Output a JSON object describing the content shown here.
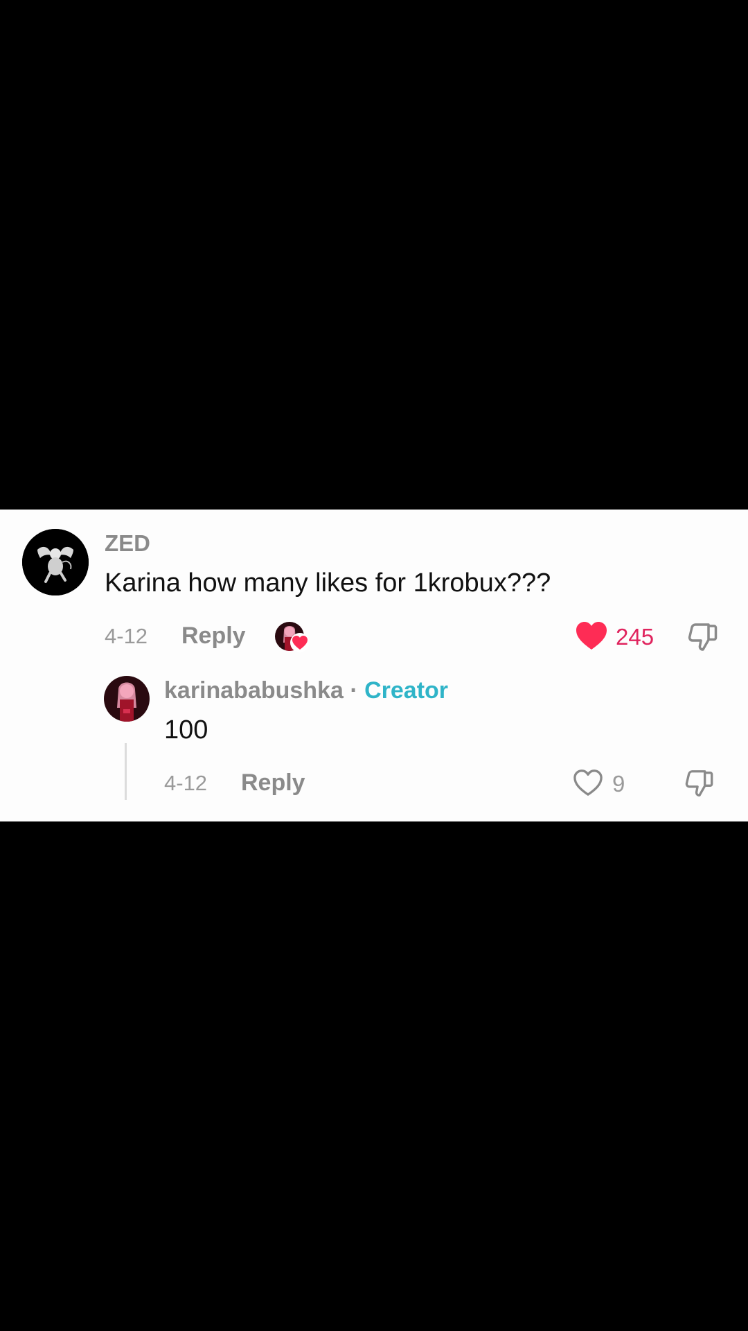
{
  "comment": {
    "username": "ZED",
    "text": "Karina how many likes for 1krobux???",
    "date": "4-12",
    "reply_label": "Reply",
    "like_count": "245",
    "liked": true,
    "liked_by_creator": true,
    "avatar_icon": "cherub-icon"
  },
  "reply": {
    "username": "karinababushka",
    "separator": " · ",
    "badge": "Creator",
    "text": "100",
    "date": "4-12",
    "reply_label": "Reply",
    "like_count": "9",
    "liked": false
  },
  "colors": {
    "like_active": "#fe2c55",
    "like_count_active": "#e0245e",
    "creator_badge": "#2fb4c8",
    "muted_text": "#8a8a8a",
    "background": "#000000",
    "panel": "#fdfdfd"
  }
}
